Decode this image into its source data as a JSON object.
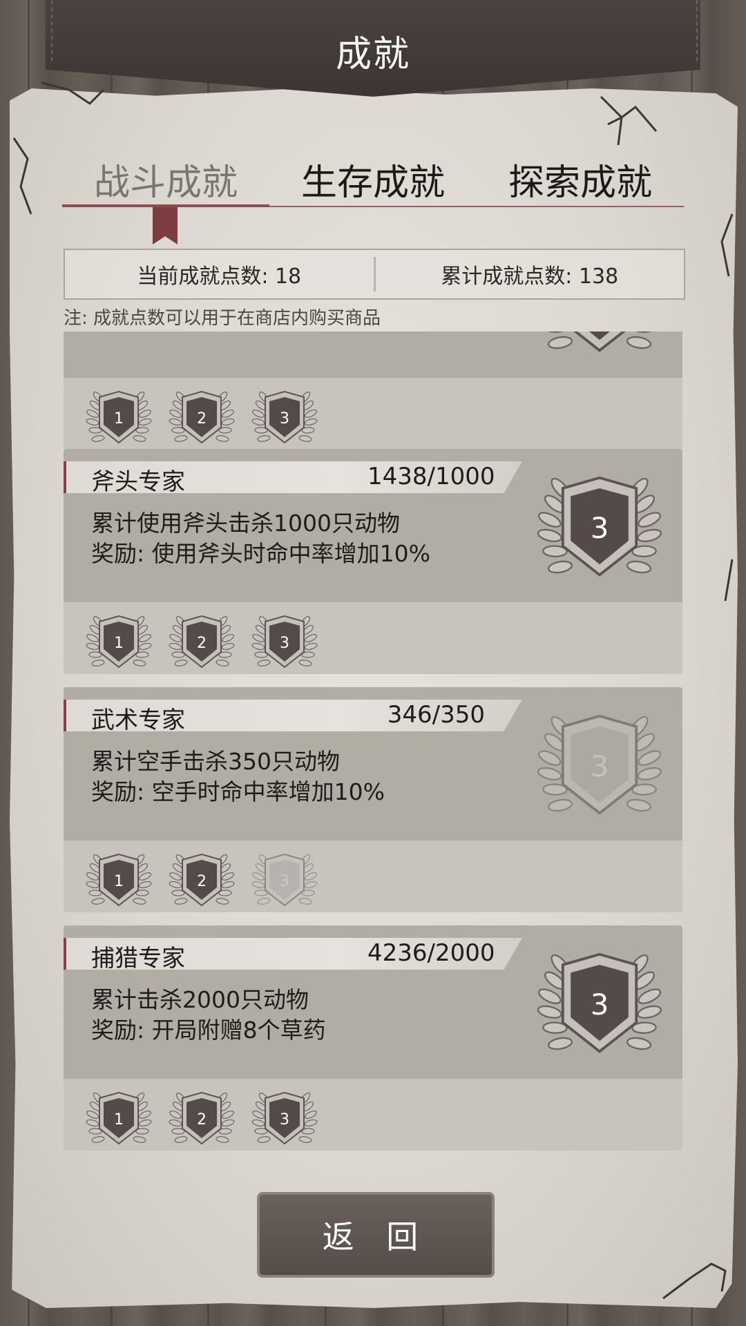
{
  "header": {
    "title": "成就"
  },
  "tabs": [
    {
      "label": "战斗成就",
      "active": true
    },
    {
      "label": "生存成就",
      "active": false
    },
    {
      "label": "探索成就",
      "active": false
    }
  ],
  "points": {
    "current": "当前成就点数: 18",
    "total": "累计成就点数: 138"
  },
  "note": "注: 成就点数可以用于在商店内购买商品",
  "partial_card": {
    "badges": [
      "1",
      "2",
      "3"
    ]
  },
  "achievements": [
    {
      "name": "斧头专家",
      "progress": "1438/1000",
      "desc": "累计使用斧头击杀1000只动物",
      "reward": "奖励: 使用斧头时命中率增加10%",
      "level": "3",
      "level_achieved": true,
      "badges": [
        "1",
        "2",
        "3"
      ],
      "badges_achieved": [
        true,
        true,
        true
      ]
    },
    {
      "name": "武术专家",
      "progress": "346/350",
      "desc": "累计空手击杀350只动物",
      "reward": "奖励: 空手时命中率增加10%",
      "level": "3",
      "level_achieved": false,
      "badges": [
        "1",
        "2",
        "3"
      ],
      "badges_achieved": [
        true,
        true,
        false
      ]
    },
    {
      "name": "捕猎专家",
      "progress": "4236/2000",
      "desc": "累计击杀2000只动物",
      "reward": "奖励: 开局附赠8个草药",
      "level": "3",
      "level_achieved": true,
      "badges": [
        "1",
        "2",
        "3"
      ],
      "badges_achieved": [
        true,
        true,
        true
      ]
    }
  ],
  "footer": {
    "return_label": "返 回"
  },
  "colors": {
    "accent": "#8a3f42",
    "badge_fill": "#544b48",
    "paper": "#dcd8d1"
  }
}
